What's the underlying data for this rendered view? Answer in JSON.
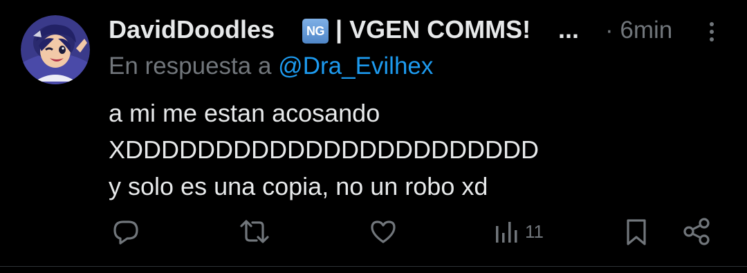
{
  "tweet": {
    "author": {
      "display_name": "DavidDoodles",
      "badge": "NG",
      "name_suffix": "| VGEN COMMS!",
      "truncation": "...",
      "avatar_icon": "cartoon-avatar"
    },
    "timestamp": "· 6min",
    "reply_prefix": "En respuesta a",
    "reply_handle": "@Dra_Evilhex",
    "text_lines": [
      "a mi me estan acosando",
      "XDDDDDDDDDDDDDDDDDDDDDDD",
      "y solo es una copia, no un robo xd"
    ],
    "actions": {
      "reply_icon": "comment-icon",
      "retweet_icon": "retweet-icon",
      "like_icon": "heart-icon",
      "views_icon": "bar-chart-icon",
      "views_count": "11",
      "bookmark_icon": "bookmark-icon",
      "share_icon": "share-icon"
    }
  },
  "colors": {
    "background": "#000000",
    "text": "#e7e9ea",
    "muted": "#71767b",
    "link": "#1d9bf0",
    "divider": "#2f3336"
  }
}
